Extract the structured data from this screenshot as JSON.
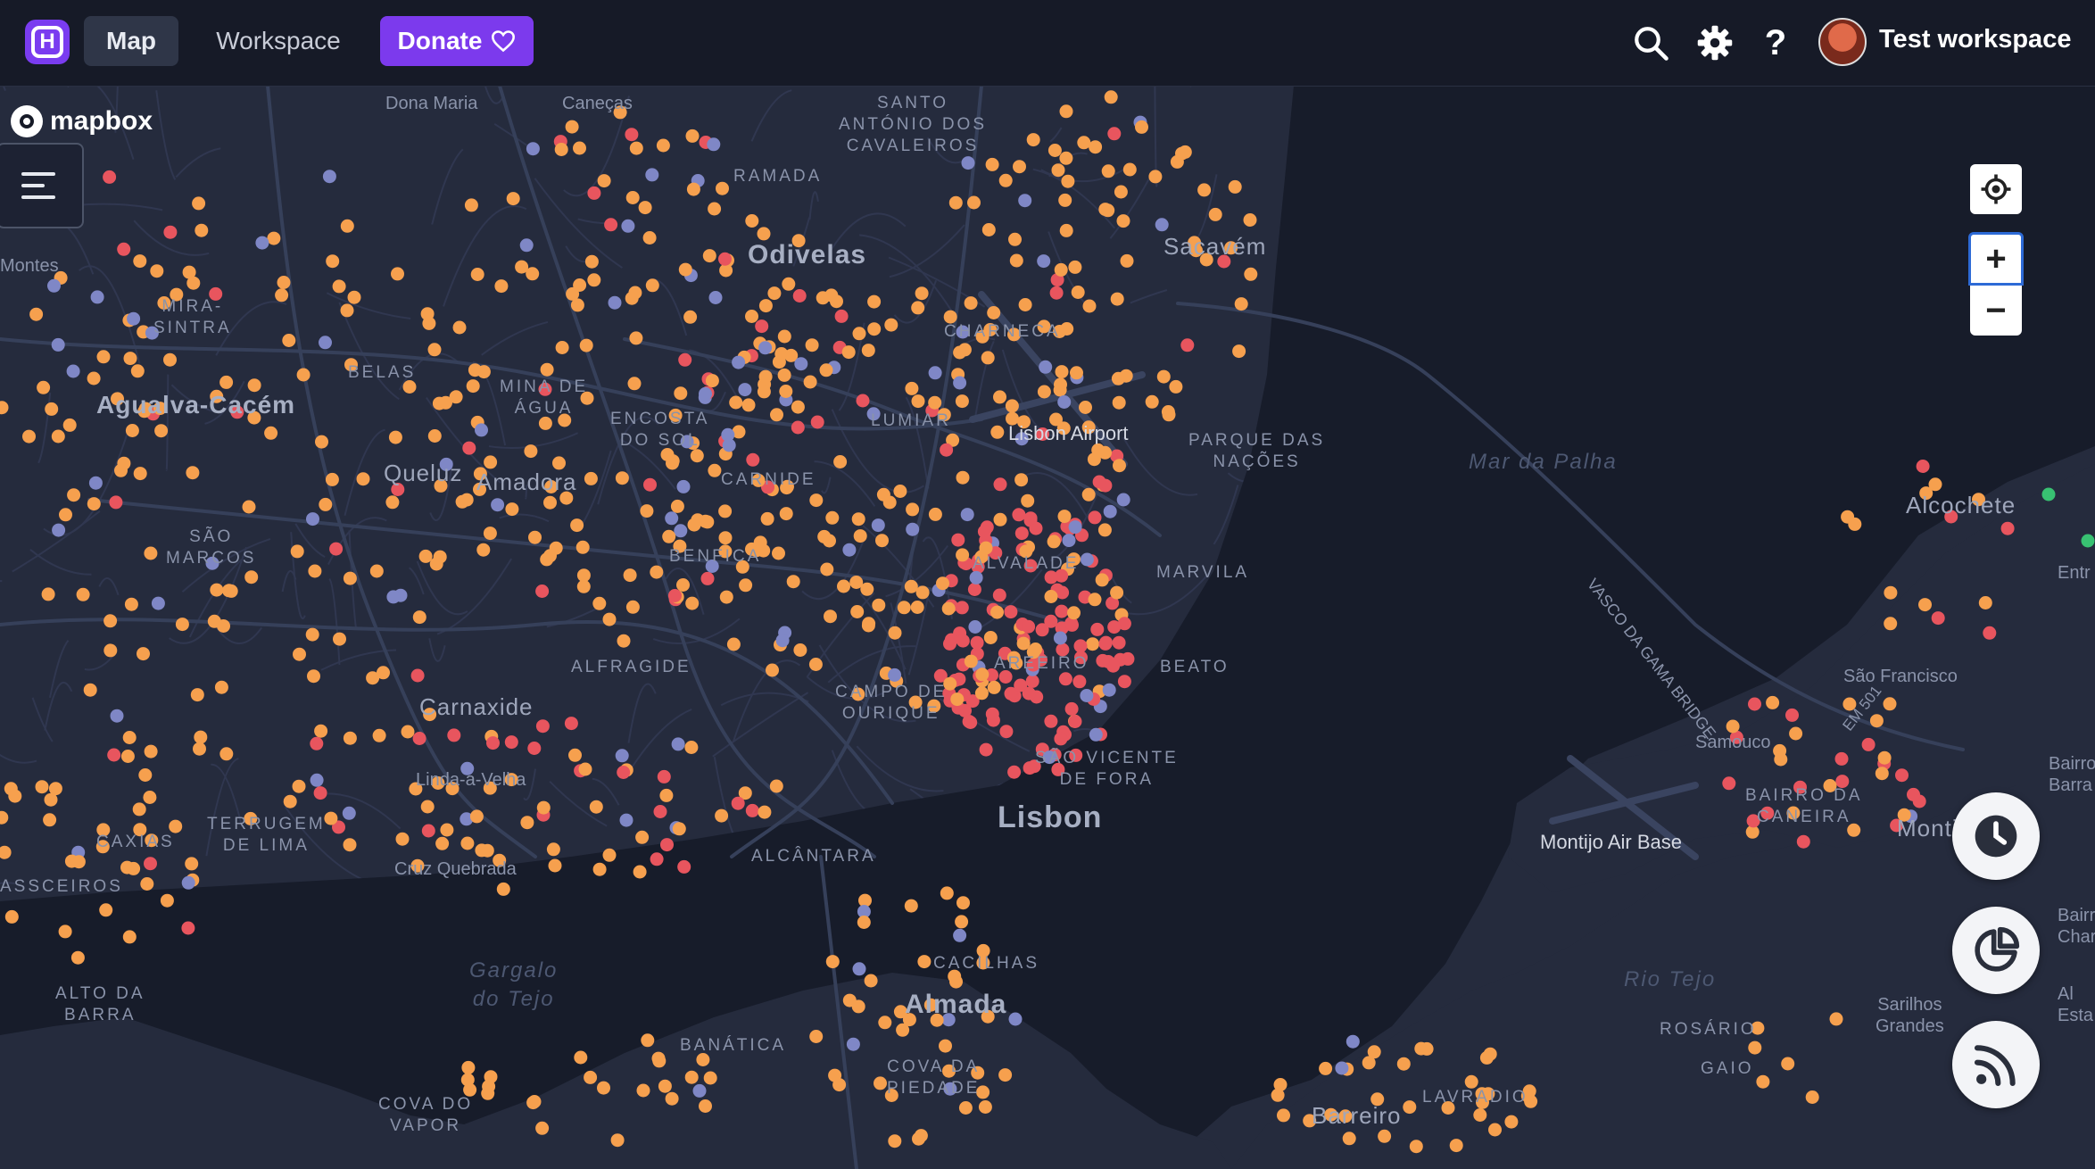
{
  "topbar": {
    "logo_letter": "H",
    "nav_map": "Map",
    "nav_workspace": "Workspace",
    "donate_label": "Donate",
    "workspace_name": "Test workspace",
    "icons": [
      "search-icon",
      "gear-icon",
      "help-icon",
      "heart-icon"
    ]
  },
  "map": {
    "attribution": "mapbox",
    "labels": {
      "odivelas": "Odivelas",
      "lisbon": "Lisbon",
      "agualva": "Agualva-Cacém",
      "carnaxide": "Carnaxide",
      "almada": "Almada",
      "barreiro": "Barreiro",
      "sacavem": "Sacavém",
      "amadora": "Amadora",
      "queluz": "Queluz",
      "alcochete": "Alcochete",
      "montijo": "Montijo",
      "airport": "Lisbon Airport",
      "montijo_base": "Montijo Air Base",
      "mar_palha": "Mar da Palha",
      "gargalo": "Gargalo\ndo Tejo",
      "rio_tejo": "Rio Tejo",
      "bridge": "Vasco da Gama Bridge",
      "em501": "EM 501",
      "santo_antonio": "SANTO\nANTÓNIO DOS\nCAVALEIROS",
      "ramada": "RAMADA",
      "charneca": "CHARNECA",
      "lumiar": "LUMIAR",
      "parque": "PARQUE DAS\nNAÇÕES",
      "mina": "MINA DE\nÁGUA",
      "encosta": "ENCOSTA\nDO SOL",
      "carnide": "CARNIDE",
      "benfica": "BENFICA",
      "alvalade": "ALVALADE",
      "marvila": "MARVILA",
      "areeiro": "AREEIRO",
      "beato": "BEATO",
      "alfragide": "ALFRAGIDE",
      "campo": "CAMPO DE\nOURIQUE",
      "sao_vicente": "SÃO VICENTE\nDE FORA",
      "alcantara": "ALCÂNTARA",
      "mira_sintra": "MIRA-\nSINTRA",
      "belas": "BELAS",
      "sao_marcos": "SÃO\nMARCOS",
      "terrugem": "TERRUGEM\nDE LIMA",
      "cacilhas_w": "CACILHAS",
      "linda": "Linda-a-Velha",
      "cruz": "Cruz Quebrada",
      "alto_barra": "ALTO DA\nBARRA",
      "cacilhas": "CACILHAS",
      "banatica": "BANÁTICA",
      "cova_piedade": "COVA DA\nPIEDADE",
      "cova_vapor": "COVA DO\nVAPOR",
      "lavradio": "LAVRADIO",
      "rosario": "ROSÁRIO",
      "gaio": "GAIO",
      "bairro_caneira": "BAIRRO DA\nCANEIRA",
      "sao_francisco": "São Francisco",
      "samouco": "Samouco",
      "sarilhos": "Sarilhos\nGrandes",
      "dona_maria": "Dona Maria",
      "caneças": "Caneças",
      "montes": "Montes",
      "sesc": "ASSCEIROS",
      "caxias": "CAXIAS",
      "entr": "Entr",
      "bairro_barr": "Bairro d\nBarra",
      "bairr_charq": "Bairr\nCharq",
      "esta": "Al\nEsta"
    }
  },
  "controls": {
    "locate": "locate-icon",
    "zoom_in": "+",
    "zoom_out": "−",
    "history": "clock-icon",
    "stats": "pie-chart-icon",
    "feed": "rss-icon"
  },
  "colors": {
    "orange": "#f6a04e",
    "red": "#e8555e",
    "purple": "#7f87c6",
    "green": "#38c172",
    "accent": "#7c3aed"
  }
}
